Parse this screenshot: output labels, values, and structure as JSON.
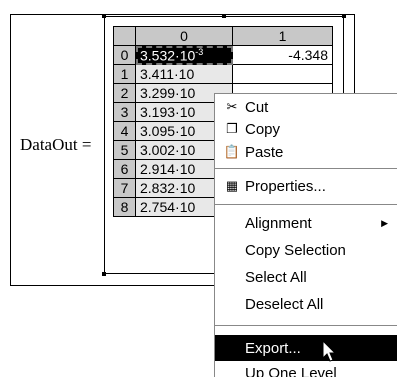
{
  "label": "DataOut =",
  "grid": {
    "col_headers": [
      "",
      "0",
      "1"
    ],
    "rows": [
      {
        "idx": "0",
        "v0": "3.532·10",
        "exp": "-3",
        "v1": "-4.348"
      },
      {
        "idx": "1",
        "v0": "3.411·10",
        "exp": "",
        "v1": ""
      },
      {
        "idx": "2",
        "v0": "3.299·10",
        "exp": "",
        "v1": ""
      },
      {
        "idx": "3",
        "v0": "3.193·10",
        "exp": "",
        "v1": ""
      },
      {
        "idx": "4",
        "v0": "3.095·10",
        "exp": "",
        "v1": ""
      },
      {
        "idx": "5",
        "v0": "3.002·10",
        "exp": "",
        "v1": ""
      },
      {
        "idx": "6",
        "v0": "2.914·10",
        "exp": "",
        "v1": ""
      },
      {
        "idx": "7",
        "v0": "2.832·10",
        "exp": "",
        "v1": ""
      },
      {
        "idx": "8",
        "v0": "2.754·10",
        "exp": "",
        "v1": ""
      }
    ]
  },
  "context_menu": {
    "cut": "Cut",
    "copy": "Copy",
    "paste": "Paste",
    "properties": "Properties...",
    "alignment": "Alignment",
    "copy_selection": "Copy Selection",
    "select_all": "Select All",
    "deselect_all": "Deselect All",
    "export": "Export...",
    "up_one_level": "Up One Level"
  },
  "icons": {
    "cut": "scissors-icon",
    "copy": "copy-icon",
    "paste": "paste-icon",
    "properties": "properties-icon",
    "submenu": "submenu-arrow-icon",
    "pointer": "mouse-pointer-icon"
  }
}
